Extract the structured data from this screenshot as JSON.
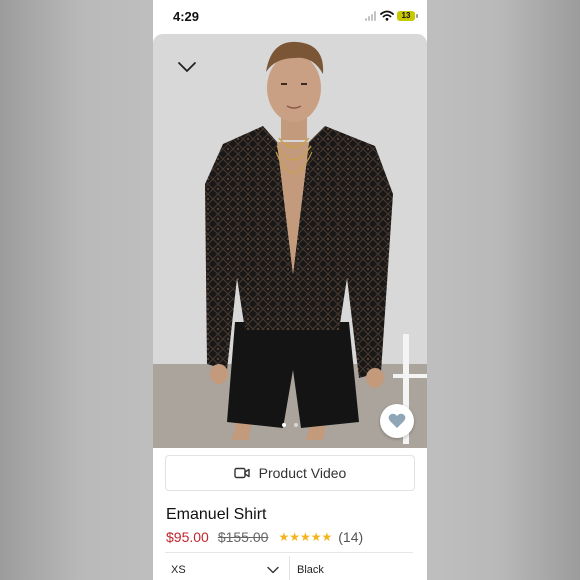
{
  "status_bar": {
    "time": "4:29",
    "battery": "13"
  },
  "product": {
    "name": "Emanuel Shirt",
    "price": "$95.00",
    "original_price": "$155.00",
    "rating_stars": 5,
    "review_count": "(14)"
  },
  "media": {
    "video_button_label": "Product Video",
    "image_index": 1,
    "image_count": 2
  },
  "options": {
    "size": "XS",
    "color": "Black"
  },
  "colors": {
    "price": "#c0262d",
    "star": "#f3b51c",
    "heart": "#8fa6b6"
  }
}
